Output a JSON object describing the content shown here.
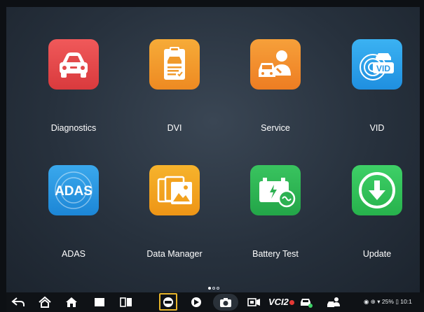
{
  "apps": [
    {
      "label": "Diagnostics",
      "icon": "car-icon",
      "color": "#e84a4a"
    },
    {
      "label": "DVI",
      "icon": "clipboard-car-icon",
      "color": "#f29a2e"
    },
    {
      "label": "Service",
      "icon": "mechanic-icon",
      "color": "#f28a2b"
    },
    {
      "label": "VID",
      "icon": "vid-icon",
      "color": "#2fa4ee"
    },
    {
      "label": "ADAS",
      "icon": "adas-icon",
      "color": "#2e9be6"
    },
    {
      "label": "Data Manager",
      "icon": "photos-icon",
      "color": "#f2a31f"
    },
    {
      "label": "Battery Test",
      "icon": "battery-icon",
      "color": "#2fba56"
    },
    {
      "label": "Update",
      "icon": "download-icon",
      "color": "#35c15a"
    }
  ],
  "pager": {
    "pages": 3,
    "active": 0
  },
  "navbar": {
    "icons": [
      "back-icon",
      "home-alt-icon",
      "home-icon",
      "recents-icon",
      "split-icon",
      "obd-icon",
      "browser-icon",
      "camera-icon",
      "screen-record-icon",
      "vci-icon",
      "car-connect-icon",
      "mechanic-small-icon"
    ],
    "vci_label": "VCI2",
    "status_text": "◉ ⊕ ▾ 25% ▯ 10:1"
  },
  "adas_text": "ADAS",
  "vid_text": "VID"
}
